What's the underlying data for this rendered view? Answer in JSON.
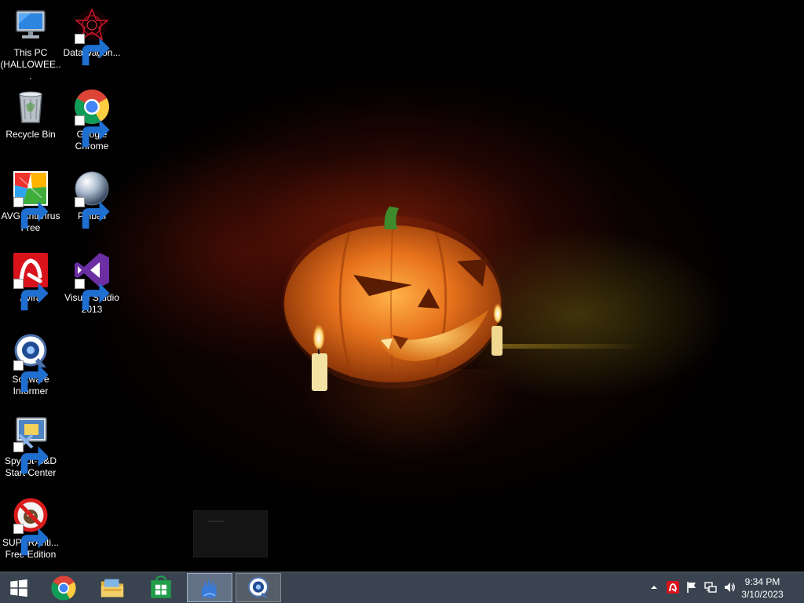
{
  "desktop": {
    "wallpaper": "halloween-pumpkin",
    "icons": [
      {
        "id": "this-pc",
        "label": "This PC (HALLOWEE...",
        "icon": "computer-icon",
        "shortcut": false
      },
      {
        "id": "datawagon",
        "label": "DataWagon...",
        "icon": "datawagon-icon",
        "shortcut": true
      },
      {
        "id": "recycle-bin",
        "label": "Recycle Bin",
        "icon": "recycle-bin-icon",
        "shortcut": false
      },
      {
        "id": "google-chrome",
        "label": "Google Chrome",
        "icon": "chrome-icon",
        "shortcut": true
      },
      {
        "id": "avg",
        "label": "AVG AntiVirus Free",
        "icon": "avg-icon",
        "shortcut": true
      },
      {
        "id": "pinball",
        "label": "Pinball",
        "icon": "pinball-icon",
        "shortcut": true
      },
      {
        "id": "avira",
        "label": "Avira",
        "icon": "avira-icon",
        "shortcut": true
      },
      {
        "id": "visual-studio",
        "label": "Visual Studio 2013",
        "icon": "visual-studio-icon",
        "shortcut": true
      },
      {
        "id": "software-informer",
        "label": "Software Informer",
        "icon": "software-informer-icon",
        "shortcut": true
      },
      {
        "id": "spybot",
        "label": "Spybot-S&D Start Center",
        "icon": "spybot-icon",
        "shortcut": true
      },
      {
        "id": "superantispyware",
        "label": "SUPERAnti... Free Edition",
        "icon": "superantispyware-icon",
        "shortcut": true
      }
    ]
  },
  "taskbar": {
    "buttons": [
      {
        "id": "start",
        "icon": "windows-logo-icon"
      },
      {
        "id": "chrome",
        "icon": "chrome-icon"
      },
      {
        "id": "file-explorer",
        "icon": "folder-icon"
      },
      {
        "id": "store",
        "icon": "store-icon"
      },
      {
        "id": "hand-app",
        "icon": "hand-app-icon",
        "state": "active"
      },
      {
        "id": "software-informer",
        "icon": "software-informer-icon",
        "state": "open"
      }
    ],
    "tray": {
      "icons": [
        "chevron-up-icon",
        "avira-tray-icon",
        "flag-icon",
        "network-icon",
        "volume-icon"
      ]
    },
    "clock": {
      "time": "9:34 PM",
      "date": "3/10/2023"
    }
  },
  "colors": {
    "taskbar_bg": "#3a4450",
    "pumpkin": "#e8721c",
    "stem": "#3e8a2c",
    "avira_red": "#d8131c",
    "vs_purple": "#6b2fa3"
  }
}
